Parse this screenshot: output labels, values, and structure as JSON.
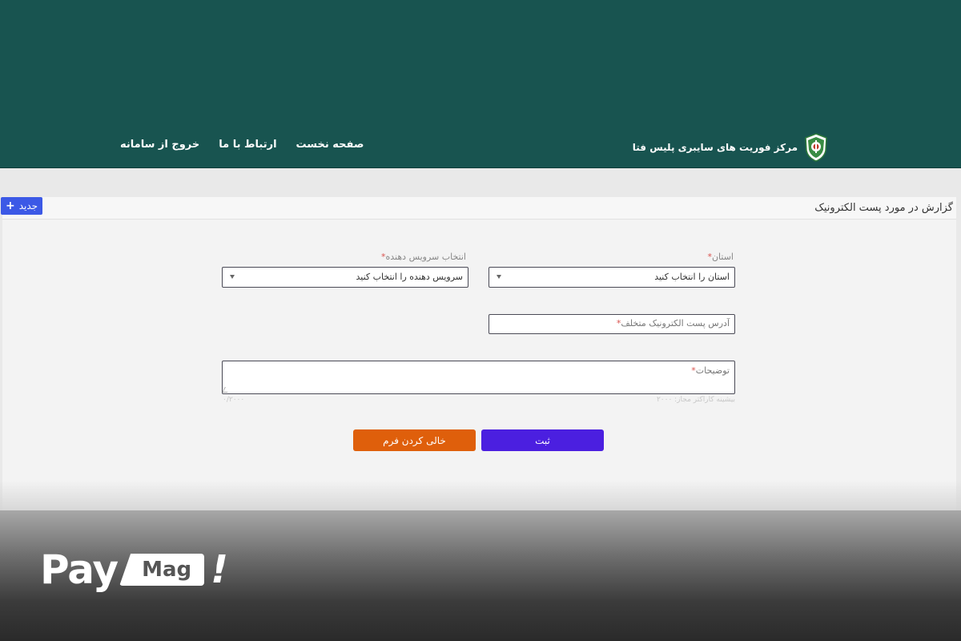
{
  "header": {
    "brand_title": "مرکز فوریت های سایبری پلیس فتا",
    "nav": [
      {
        "label": "صفحه نخست"
      },
      {
        "label": "ارتباط با ما"
      },
      {
        "label": "خروج از سامانه"
      }
    ]
  },
  "panel": {
    "title": "گزارش در مورد پست الکترونیک",
    "new_button": "جدید"
  },
  "form": {
    "province": {
      "label": "استان",
      "required_mark": "*",
      "value": "استان را انتخاب کنید"
    },
    "provider": {
      "label": "انتخاب سرویس دهنده",
      "required_mark": "*",
      "value": "سرویس دهنده را انتخاب کنید"
    },
    "email": {
      "placeholder": "آدرس پست الکترونیک متخلف",
      "required_mark": "*"
    },
    "description": {
      "placeholder": "توضیحات",
      "required_mark": "*",
      "hint_max": "بیشینه کاراکتر مجاز: ۲۰۰۰",
      "counter": "۰/۲۰۰۰"
    },
    "submit_label": "ثبت",
    "clear_label": "خالی کردن فرم"
  },
  "watermark": {
    "pay": "Pay",
    "mag": "Mag",
    "bang": "!"
  },
  "colors": {
    "header_bg": "#185450",
    "submit_bg": "#4b1fe0",
    "clear_bg": "#df5f0b",
    "new_bg": "#3c59e6"
  }
}
